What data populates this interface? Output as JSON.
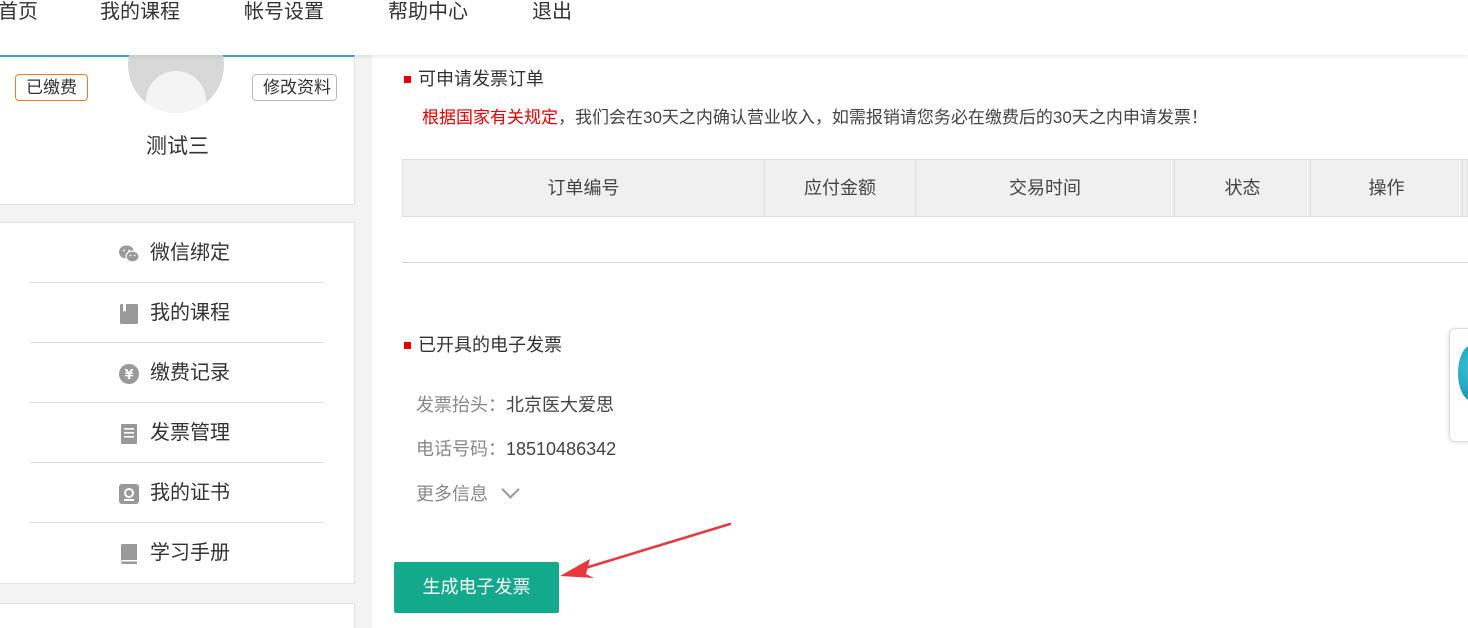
{
  "nav": {
    "items": [
      "首页",
      "我的课程",
      "帐号设置",
      "帮助中心",
      "退出"
    ]
  },
  "profile": {
    "paid_tag": "已缴费",
    "edit_button": "修改资料",
    "name": "测试三"
  },
  "sidebar": {
    "items": [
      {
        "label": "微信绑定",
        "icon": "wechat-icon"
      },
      {
        "label": "我的课程",
        "icon": "book-icon"
      },
      {
        "label": "缴费记录",
        "icon": "yen-icon"
      },
      {
        "label": "发票管理",
        "icon": "invoice-icon"
      },
      {
        "label": "我的证书",
        "icon": "certificate-icon"
      },
      {
        "label": "学习手册",
        "icon": "handbook-icon"
      }
    ]
  },
  "orders": {
    "title": "可申请发票订单",
    "notice_red": "根据国家有关规定",
    "notice_rest": "，我们会在30天之内确认营业收入，如需报销请您务必在缴费后的30天之内申请发票！",
    "columns": [
      "订单编号",
      "应付金额",
      "交易时间",
      "状态",
      "操作"
    ]
  },
  "invoices": {
    "title": "已开具的电子发票",
    "header_key": "发票抬头：",
    "header_value": "北京医大爱思",
    "phone_key": "电话号码：",
    "phone_value": "18510486342",
    "more": "更多信息"
  },
  "action": {
    "generate_label": "生成电子发票"
  },
  "colors": {
    "accent_green": "#13a98d",
    "notice_red": "#e60000",
    "paid_orange": "#e67e22",
    "arrow_red": "#e8383d"
  }
}
